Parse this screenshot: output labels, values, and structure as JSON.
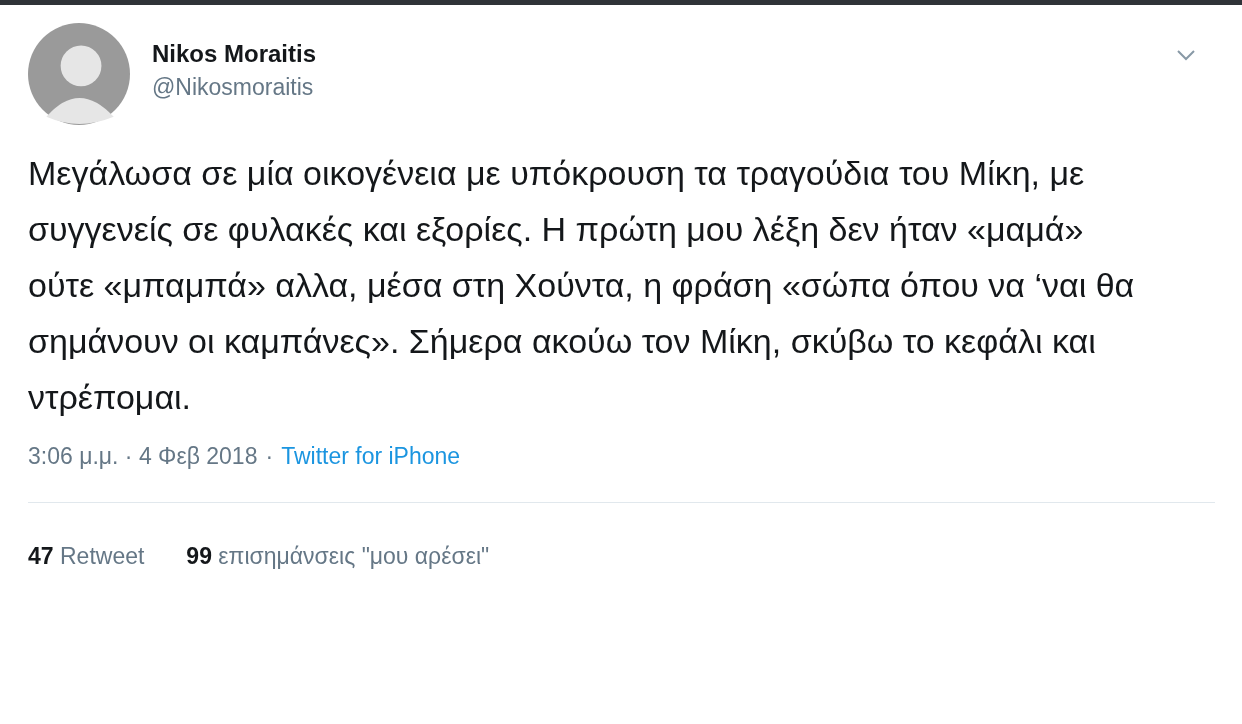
{
  "author": {
    "name": "Nikos Moraitis",
    "handle": "@Nikosmoraitis"
  },
  "tweet": {
    "text": "Μεγάλωσα σε μία οικογένεια με υπόκρουση τα τραγούδια του Μίκη, με συγγενείς σε φυλακές και εξορίες. Η πρώτη μου λέξη δεν ήταν «μαμά» ούτε «μπαμπά» αλλα, μέσα στη Χούντα, η φράση «σώπα όπου να ‘ναι θα σημάνουν οι καμπάνες». Σήμερα ακούω τον Μίκη, σκύβω το κεφάλι και ντρέπομαι.",
    "time": "3:06 μ.μ. · 4 Φεβ 2018",
    "separator": "·",
    "source": "Twitter for iPhone"
  },
  "stats": [
    {
      "count": "47",
      "label": "Retweet"
    },
    {
      "count": "99",
      "label": "επισημάνσεις \"μου αρέσει\""
    }
  ]
}
